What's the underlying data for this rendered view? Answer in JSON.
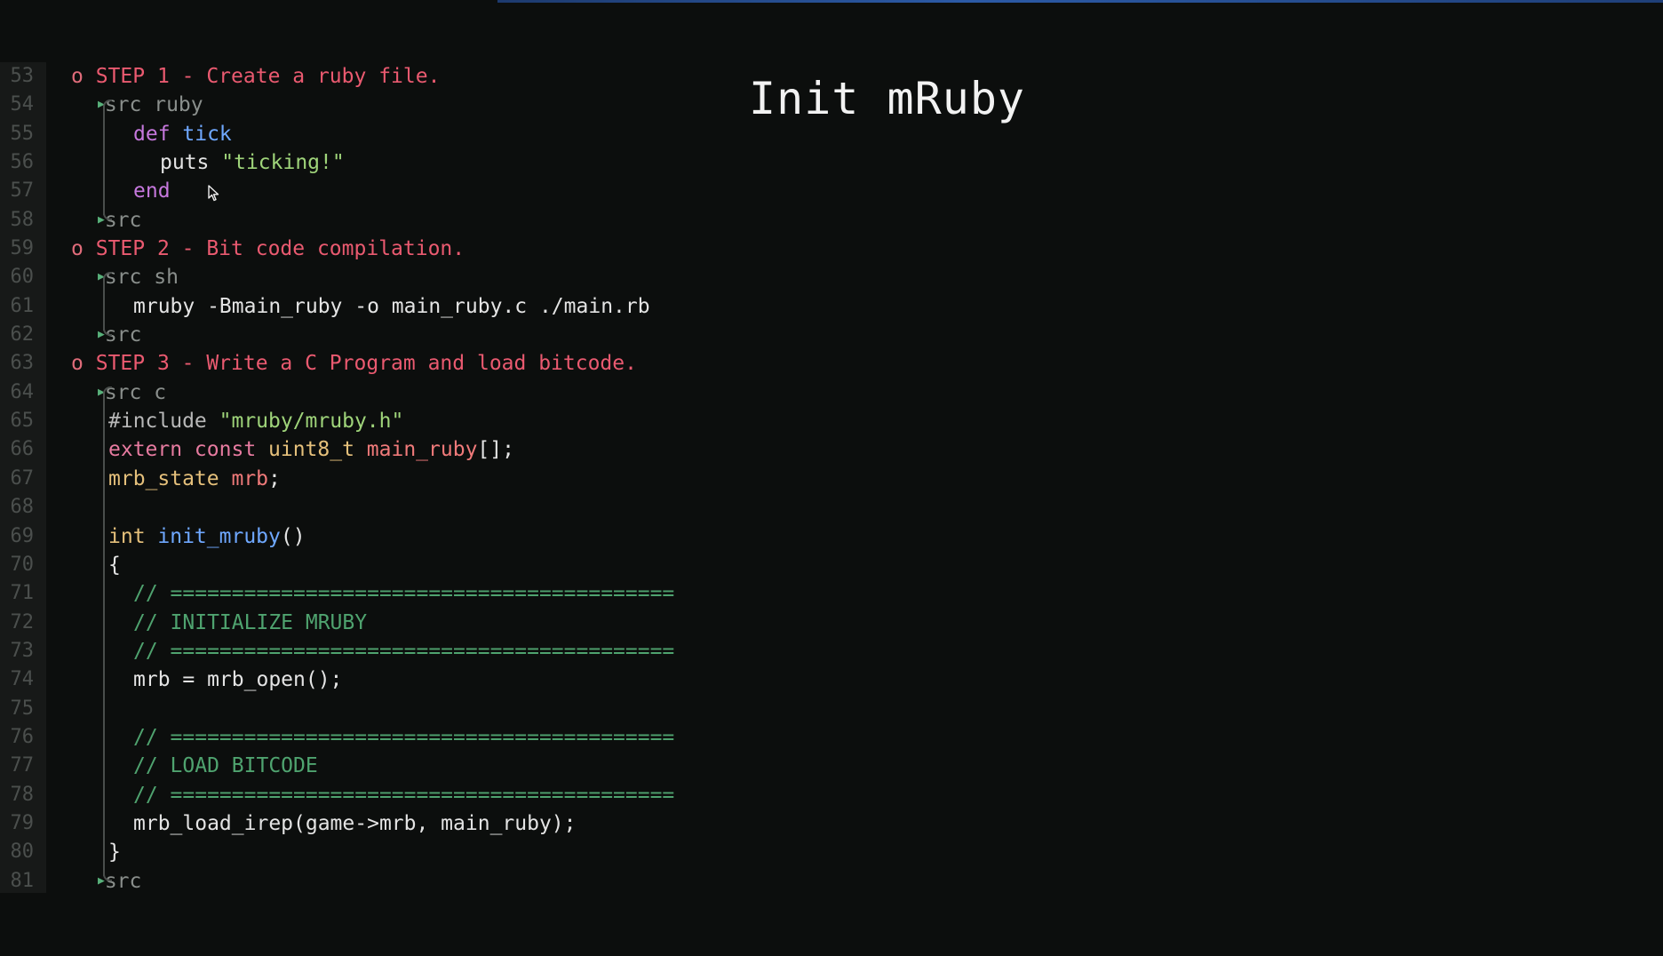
{
  "slide": {
    "title": "Init mRuby"
  },
  "editor": {
    "lines": [
      {
        "n": "53",
        "parts": [
          {
            "c": "bullet",
            "t": "o "
          },
          {
            "c": "hd",
            "t": "STEP 1 - Create a ruby file."
          }
        ],
        "indent": 0
      },
      {
        "n": "54",
        "parts": [
          {
            "c": "tri",
            "t": "▶"
          },
          {
            "c": "meta",
            "t": "src ruby"
          }
        ],
        "indent": 30
      },
      {
        "n": "55",
        "parts": [
          {
            "c": "kw",
            "t": "def "
          },
          {
            "c": "fn",
            "t": "tick"
          }
        ],
        "indent": 70
      },
      {
        "n": "56",
        "parts": [
          {
            "c": "plain",
            "t": "puts "
          },
          {
            "c": "str",
            "t": "\"ticking!\""
          }
        ],
        "indent": 100
      },
      {
        "n": "57",
        "parts": [
          {
            "c": "kw",
            "t": "end"
          }
        ],
        "indent": 70
      },
      {
        "n": "58",
        "parts": [
          {
            "c": "tri",
            "t": "▶"
          },
          {
            "c": "meta",
            "t": "src"
          }
        ],
        "indent": 30
      },
      {
        "n": "59",
        "parts": [
          {
            "c": "bullet",
            "t": "o "
          },
          {
            "c": "hd",
            "t": "STEP 2 - Bit code compilation."
          }
        ],
        "indent": 0
      },
      {
        "n": "60",
        "parts": [
          {
            "c": "tri",
            "t": "▶"
          },
          {
            "c": "meta",
            "t": "src sh"
          }
        ],
        "indent": 30
      },
      {
        "n": "61",
        "parts": [
          {
            "c": "plain",
            "t": "mruby -Bmain_ruby -o main_ruby.c ./main.rb"
          }
        ],
        "indent": 70
      },
      {
        "n": "62",
        "parts": [
          {
            "c": "tri",
            "t": "▶"
          },
          {
            "c": "meta",
            "t": "src"
          }
        ],
        "indent": 30
      },
      {
        "n": "63",
        "parts": [
          {
            "c": "bullet",
            "t": "o "
          },
          {
            "c": "hd",
            "t": "STEP 3 - Write a C Program and load bitcode."
          }
        ],
        "indent": 0
      },
      {
        "n": "64",
        "parts": [
          {
            "c": "tri",
            "t": "▶"
          },
          {
            "c": "meta",
            "t": "src c"
          }
        ],
        "indent": 30
      },
      {
        "n": "65",
        "parts": [
          {
            "c": "pp",
            "t": "#include "
          },
          {
            "c": "str",
            "t": "\"mruby/mruby.h\""
          }
        ],
        "indent": 42
      },
      {
        "n": "66",
        "parts": [
          {
            "c": "ck",
            "t": "extern const "
          },
          {
            "c": "type",
            "t": "uint8_t "
          },
          {
            "c": "var",
            "t": "main_ruby"
          },
          {
            "c": "plain",
            "t": "[];"
          }
        ],
        "indent": 42
      },
      {
        "n": "67",
        "parts": [
          {
            "c": "type",
            "t": "mrb_state "
          },
          {
            "c": "var",
            "t": "mrb"
          },
          {
            "c": "plain",
            "t": ";"
          }
        ],
        "indent": 42
      },
      {
        "n": "68",
        "parts": [],
        "indent": 42
      },
      {
        "n": "69",
        "parts": [
          {
            "c": "type",
            "t": "int "
          },
          {
            "c": "fn",
            "t": "init_mruby"
          },
          {
            "c": "plain",
            "t": "()"
          }
        ],
        "indent": 42
      },
      {
        "n": "70",
        "parts": [
          {
            "c": "plain",
            "t": "{"
          }
        ],
        "indent": 42
      },
      {
        "n": "71",
        "parts": [
          {
            "c": "cmt",
            "t": "// ========================================="
          }
        ],
        "indent": 70
      },
      {
        "n": "72",
        "parts": [
          {
            "c": "cmt",
            "t": "// INITIALIZE MRUBY"
          }
        ],
        "indent": 70
      },
      {
        "n": "73",
        "parts": [
          {
            "c": "cmt",
            "t": "// ========================================="
          }
        ],
        "indent": 70
      },
      {
        "n": "74",
        "parts": [
          {
            "c": "plain",
            "t": "mrb = mrb_open();"
          }
        ],
        "indent": 70
      },
      {
        "n": "75",
        "parts": [],
        "indent": 70
      },
      {
        "n": "76",
        "parts": [
          {
            "c": "cmt",
            "t": "// ========================================="
          }
        ],
        "indent": 70
      },
      {
        "n": "77",
        "parts": [
          {
            "c": "cmt",
            "t": "// LOAD BITCODE"
          }
        ],
        "indent": 70
      },
      {
        "n": "78",
        "parts": [
          {
            "c": "cmt",
            "t": "// ========================================="
          }
        ],
        "indent": 70
      },
      {
        "n": "79",
        "parts": [
          {
            "c": "plain",
            "t": "mrb_load_irep(game->mrb, main_ruby);"
          }
        ],
        "indent": 70
      },
      {
        "n": "80",
        "parts": [
          {
            "c": "plain",
            "t": "}"
          }
        ],
        "indent": 42
      },
      {
        "n": "81",
        "parts": [
          {
            "c": "tri",
            "t": "▶"
          },
          {
            "c": "meta",
            "t": "src"
          }
        ],
        "indent": 30
      }
    ]
  }
}
